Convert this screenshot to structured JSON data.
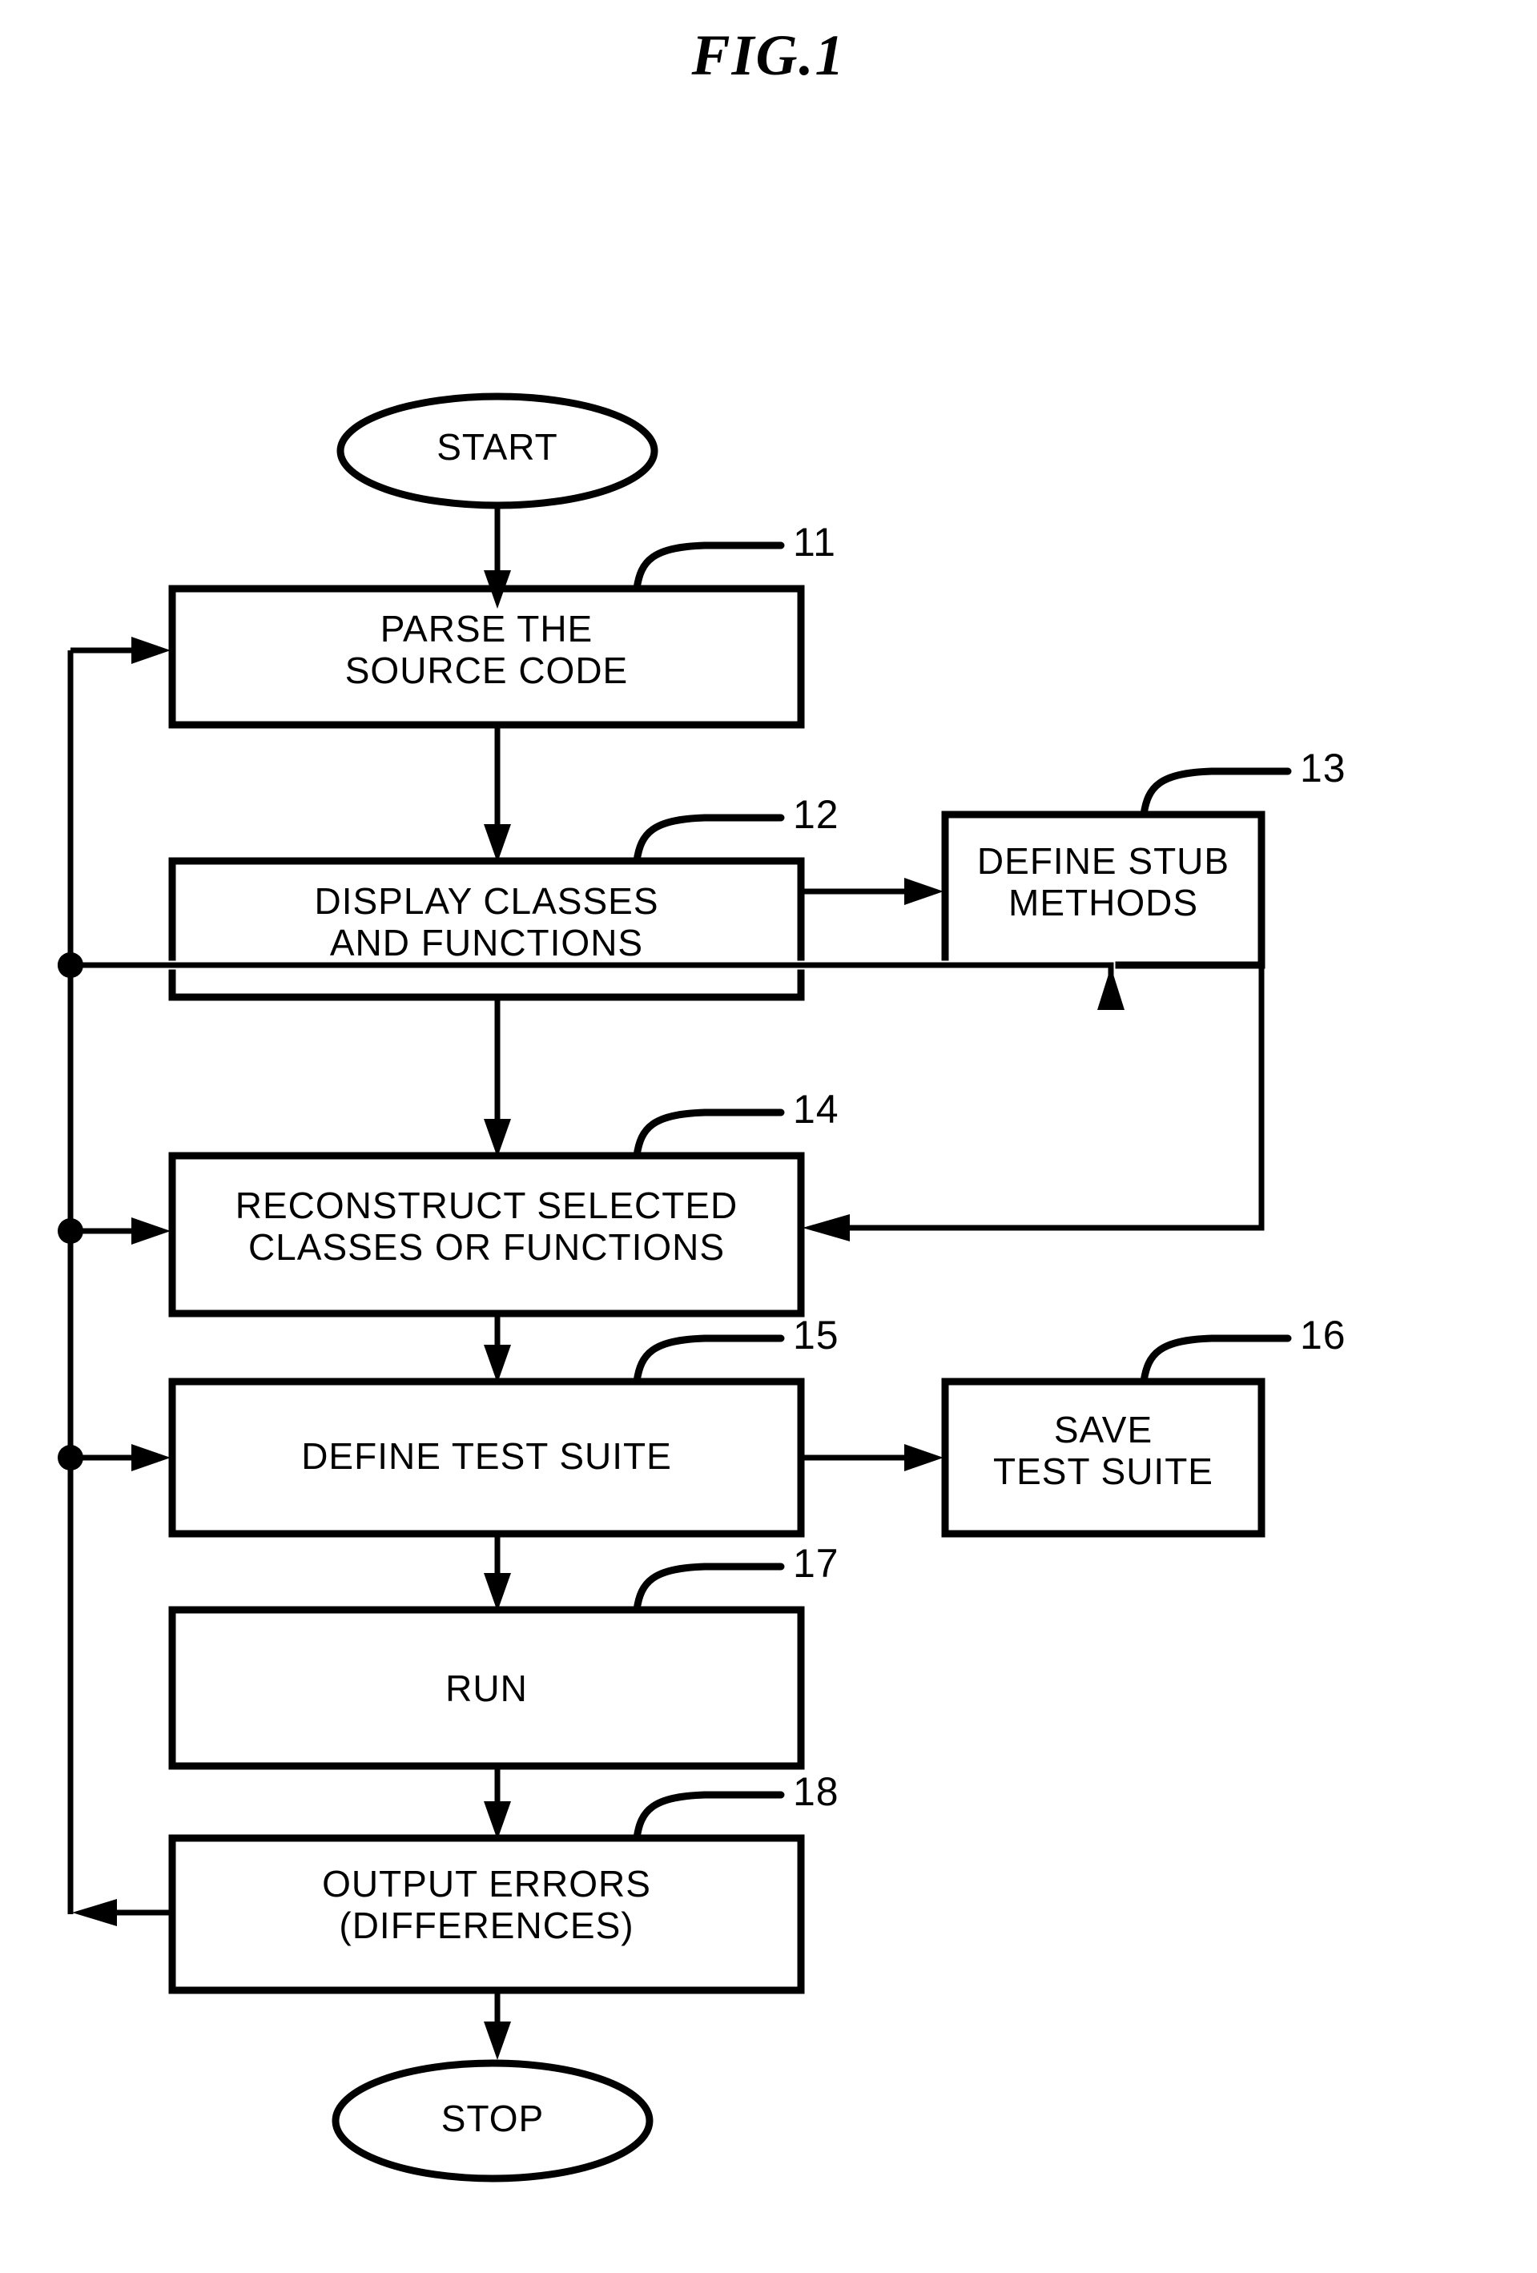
{
  "figure": {
    "title": "FIG.1",
    "type": "flowchart"
  },
  "terminals": [
    {
      "id": "start",
      "label": "START"
    },
    {
      "id": "stop",
      "label": "STOP"
    }
  ],
  "steps": [
    {
      "ref": "11",
      "label": "PARSE THE\nSOURCE CODE"
    },
    {
      "ref": "12",
      "label": "DISPLAY CLASSES\nAND FUNCTIONS"
    },
    {
      "ref": "13",
      "label": "DEFINE STUB\nMETHODS"
    },
    {
      "ref": "14",
      "label": "RECONSTRUCT SELECTED\nCLASSES OR FUNCTIONS"
    },
    {
      "ref": "15",
      "label": "DEFINE TEST SUITE"
    },
    {
      "ref": "16",
      "label": "SAVE\nTEST SUITE"
    },
    {
      "ref": "17",
      "label": "RUN"
    },
    {
      "ref": "18",
      "label": "OUTPUT ERRORS\n(DIFFERENCES)"
    }
  ],
  "colors": {
    "stroke": "#000000",
    "background": "#ffffff"
  }
}
